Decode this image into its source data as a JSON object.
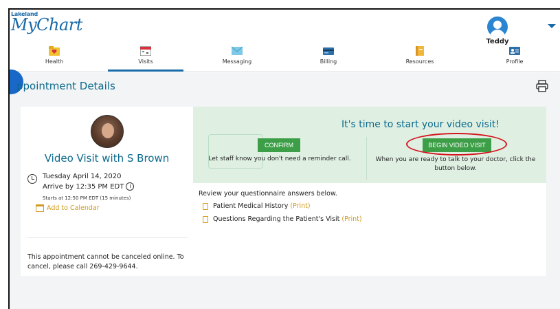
{
  "logo": {
    "small": "Lakeland",
    "big": "MyChart"
  },
  "user": {
    "name": "Teddy"
  },
  "nav": [
    {
      "label": "Health",
      "icon": "heart-folder-icon"
    },
    {
      "label": "Visits",
      "icon": "calendar-icon",
      "active": true
    },
    {
      "label": "Messaging",
      "icon": "envelope-icon"
    },
    {
      "label": "Billing",
      "icon": "credit-card-icon"
    },
    {
      "label": "Resources",
      "icon": "book-icon"
    },
    {
      "label": "Profile",
      "icon": "id-card-icon"
    }
  ],
  "page": {
    "title": "ppointment Details"
  },
  "visit": {
    "title": "Video Visit with S Brown",
    "date": "Tuesday April 14, 2020",
    "arrive": "Arrive by 12:35 PM EDT",
    "starts": "Starts at 12:50 PM EDT (15 minutes)",
    "add_calendar": "Add to Calendar",
    "cancel_note": "This appointment cannot be canceled online. To cancel, please call 269-429-9644."
  },
  "banner": {
    "title": "It's time to start your video visit!",
    "confirm_label": "CONFIRM",
    "confirm_text": "Let staff know you don't need a reminder call.",
    "begin_label": "BEGIN VIDEO VISIT",
    "begin_text": "When you are ready to talk to your doctor, click the button below."
  },
  "questionnaire": {
    "intro": "Review your questionnaire answers below.",
    "items": [
      {
        "label": "Patient Medical History",
        "print": "(Print)"
      },
      {
        "label": "Questions Regarding the Patient's Visit",
        "print": "(Print)"
      }
    ]
  },
  "colors": {
    "brand": "#1a6aa8",
    "title": "#0c6a8c",
    "button": "#3c9e46",
    "accent": "#d29a1b",
    "highlight": "#d3141c"
  }
}
